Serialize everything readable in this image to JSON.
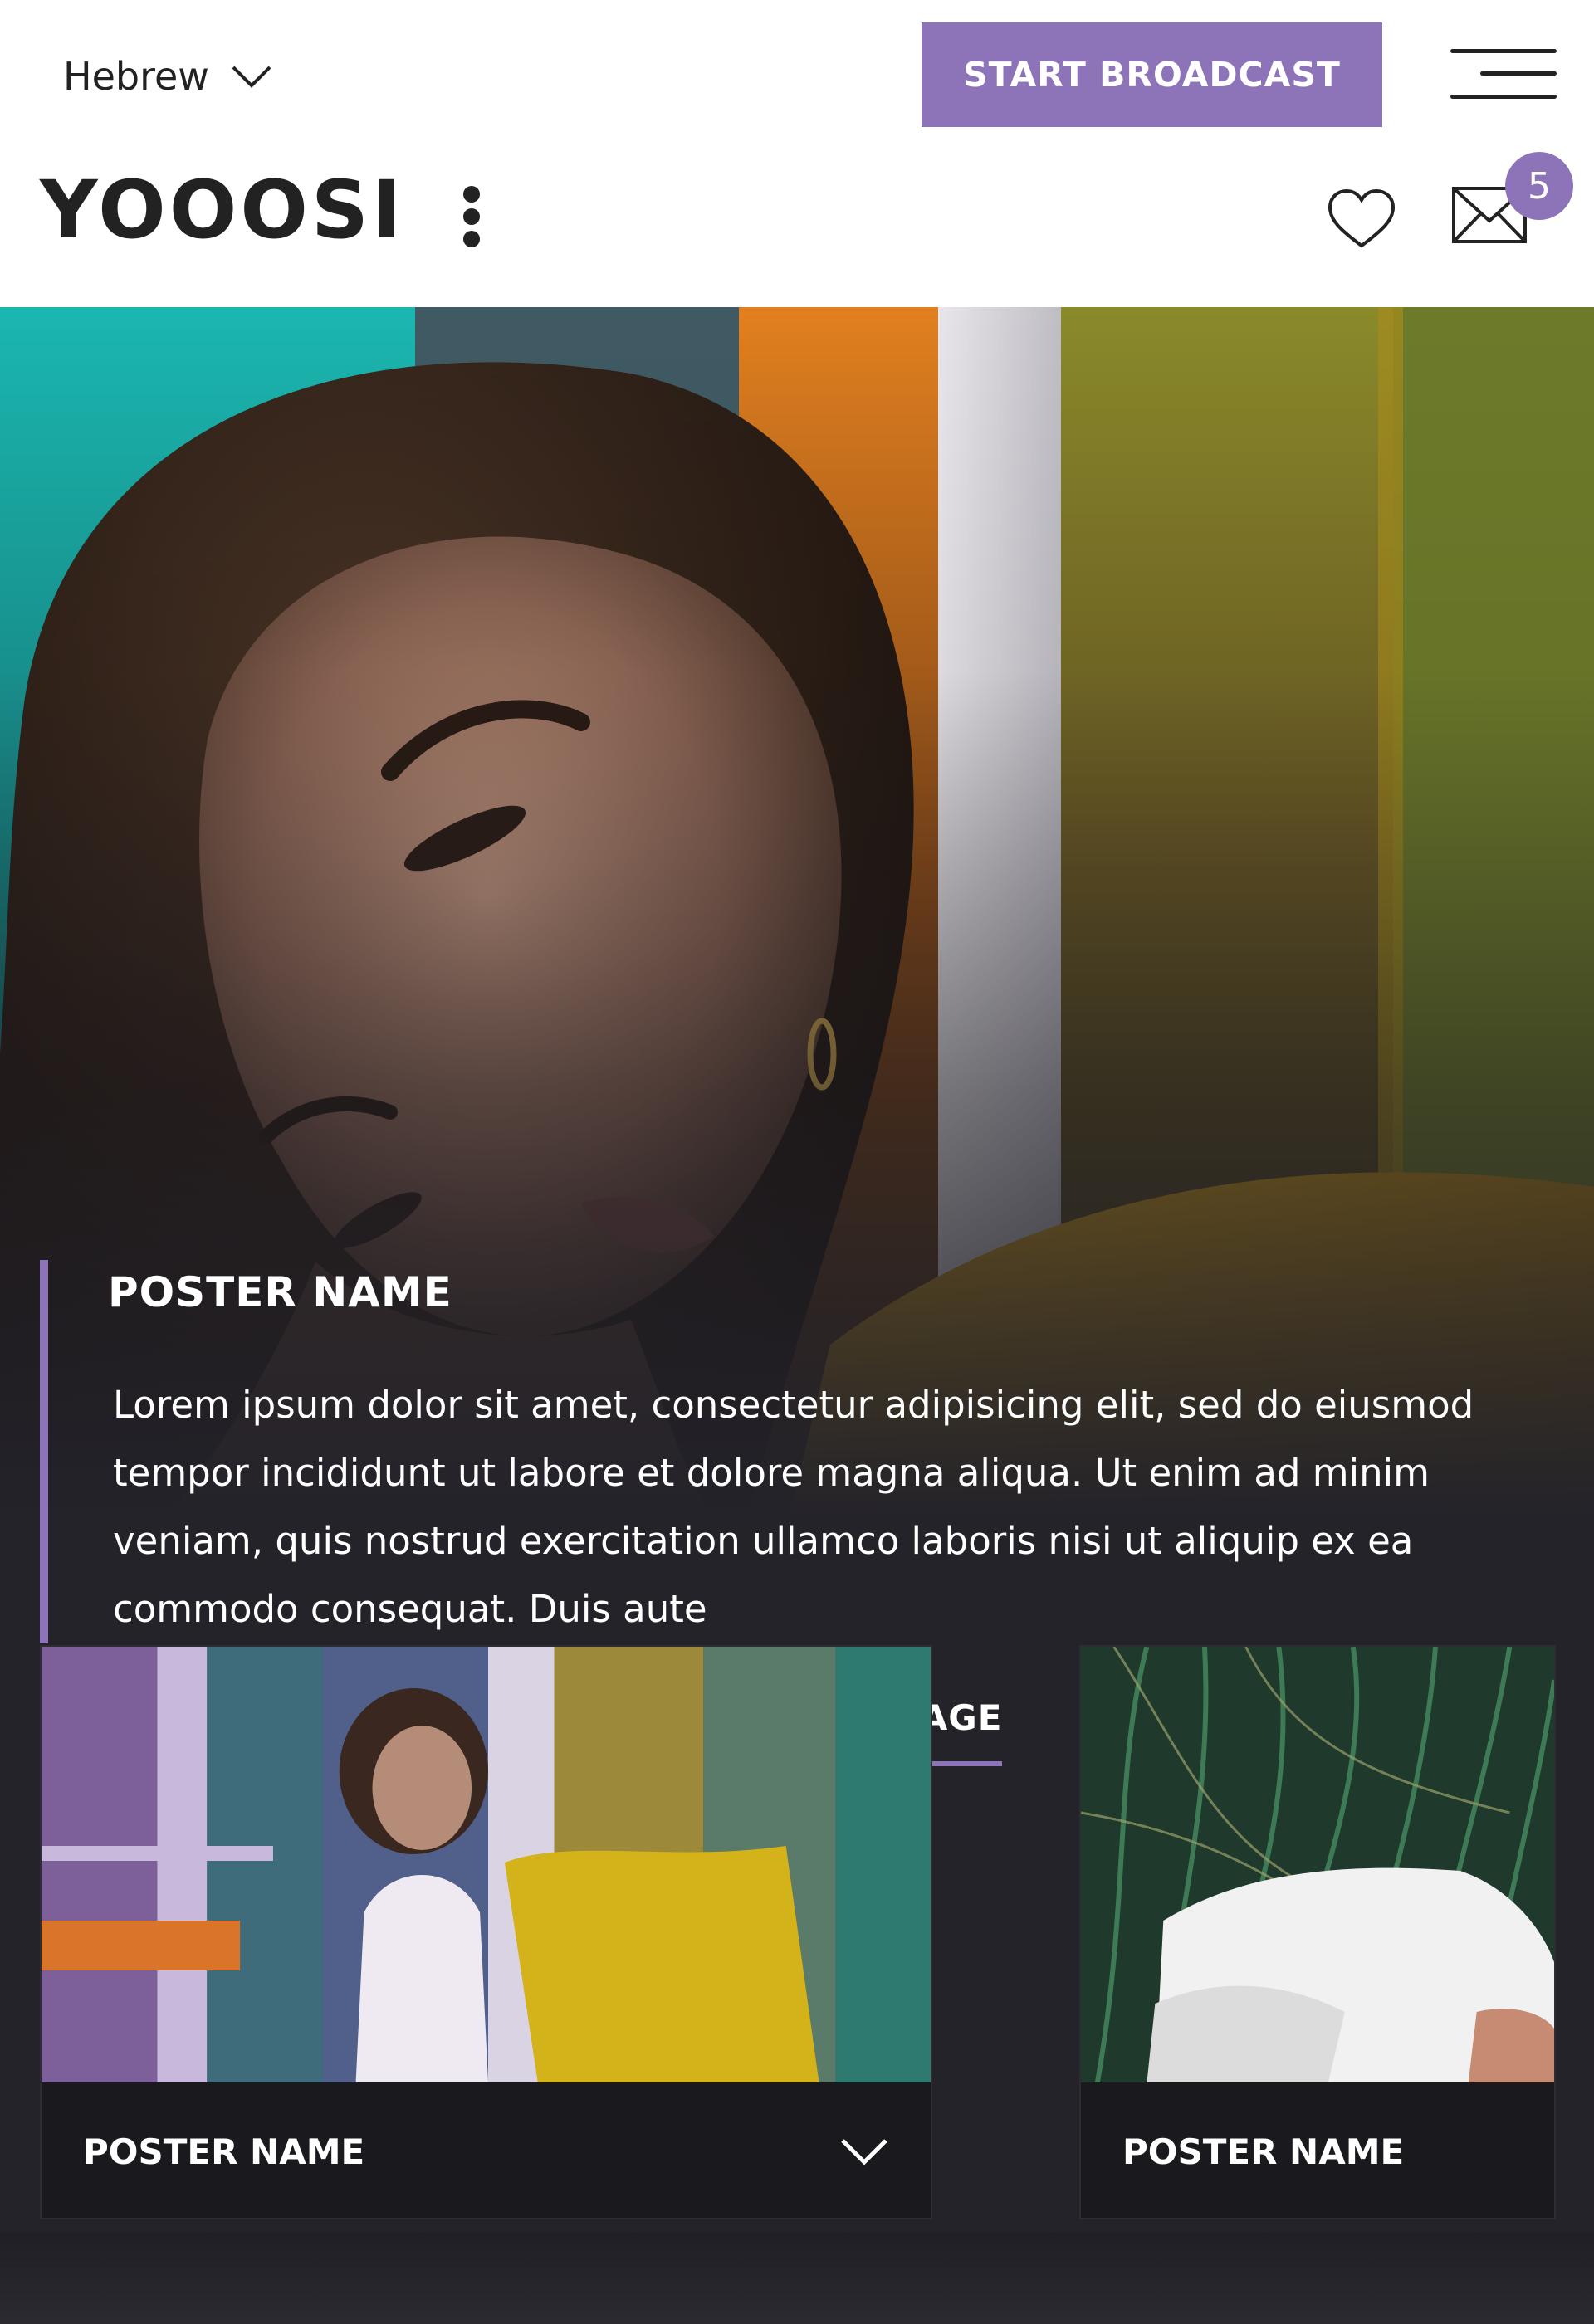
{
  "header": {
    "language": "Hebrew",
    "broadcast_label": "START BROADCAST",
    "logo": "YOOOSI",
    "mail_badge": "5"
  },
  "hero": {
    "title": "POSTER NAME",
    "text": "Lorem ipsum dolor sit amet, consectetur adipisicing elit, sed do eiusmod tempor incididunt ut labore et dolore magna aliqua. Ut enim ad minim veniam, quis nostrud exercitation ullamco laboris nisi ut aliquip ex ea commodo consequat. Duis aute",
    "author_link": "TO AUTHOR'S PAGE"
  },
  "cards": [
    {
      "title": "POSTER NAME"
    },
    {
      "title": "POSTER NAME"
    }
  ],
  "colors": {
    "accent": "#8d74b8",
    "dark_bg": "#24232a",
    "text_dark": "#222222"
  },
  "icons": [
    "chevron-down-icon",
    "hamburger-icon",
    "kebab-icon",
    "heart-icon",
    "mail-icon",
    "play-icon"
  ]
}
